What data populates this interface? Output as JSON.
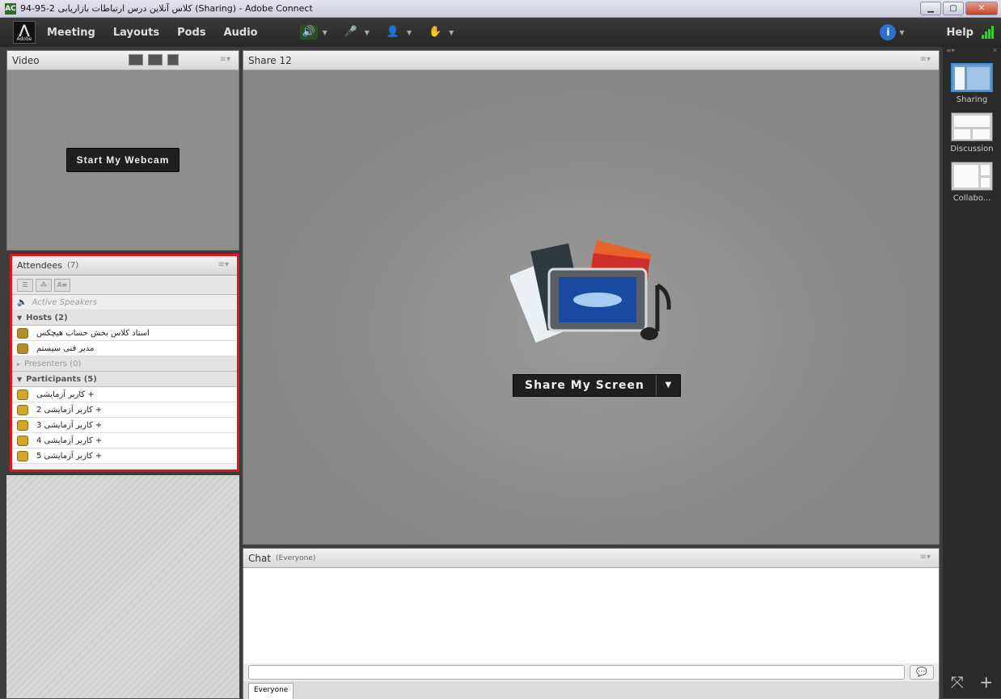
{
  "window": {
    "title": "94-95-2 کلاس آنلاین درس ارتباطات بازاریابی (Sharing) - Adobe Connect",
    "app_icon": "AC",
    "buttons": {
      "minimize": "▁",
      "maximize": "▢",
      "close": "✕"
    }
  },
  "menubar": {
    "logo": "Adobe",
    "items": [
      "Meeting",
      "Layouts",
      "Pods",
      "Audio"
    ],
    "help": "Help"
  },
  "video_pod": {
    "title": "Video",
    "start_webcam": "Start My Webcam"
  },
  "share_pod": {
    "title": "Share 12",
    "share_button": "Share My Screen"
  },
  "attendees_pod": {
    "title": "Attendees",
    "count": "(7)",
    "active_speakers": "Active Speakers",
    "hosts_label": "Hosts (2)",
    "hosts": [
      "استاد کلاس بخش حساب هیچکس",
      "مدیر فنی سیستم"
    ],
    "presenters_label": "Presenters (0)",
    "participants_label": "Participants (5)",
    "participants": [
      "کاربر آزمایشی +",
      "کاربر آزمایشی 2 +",
      "کاربر آزمایشی 3 +",
      "کاربر آزمایشی 4 +",
      "کاربر آزمایشی 5 +"
    ]
  },
  "chat_pod": {
    "title": "Chat",
    "subtitle": "(Everyone)",
    "tab": "Everyone",
    "send_icon": "💬"
  },
  "layouts_bar": {
    "items": [
      "Sharing",
      "Discussion",
      "Collabo..."
    ]
  },
  "colors": {
    "highlight_border": "#e0151e",
    "active_layout": "#3a8bd8",
    "audio_green": "#6ee14a"
  }
}
